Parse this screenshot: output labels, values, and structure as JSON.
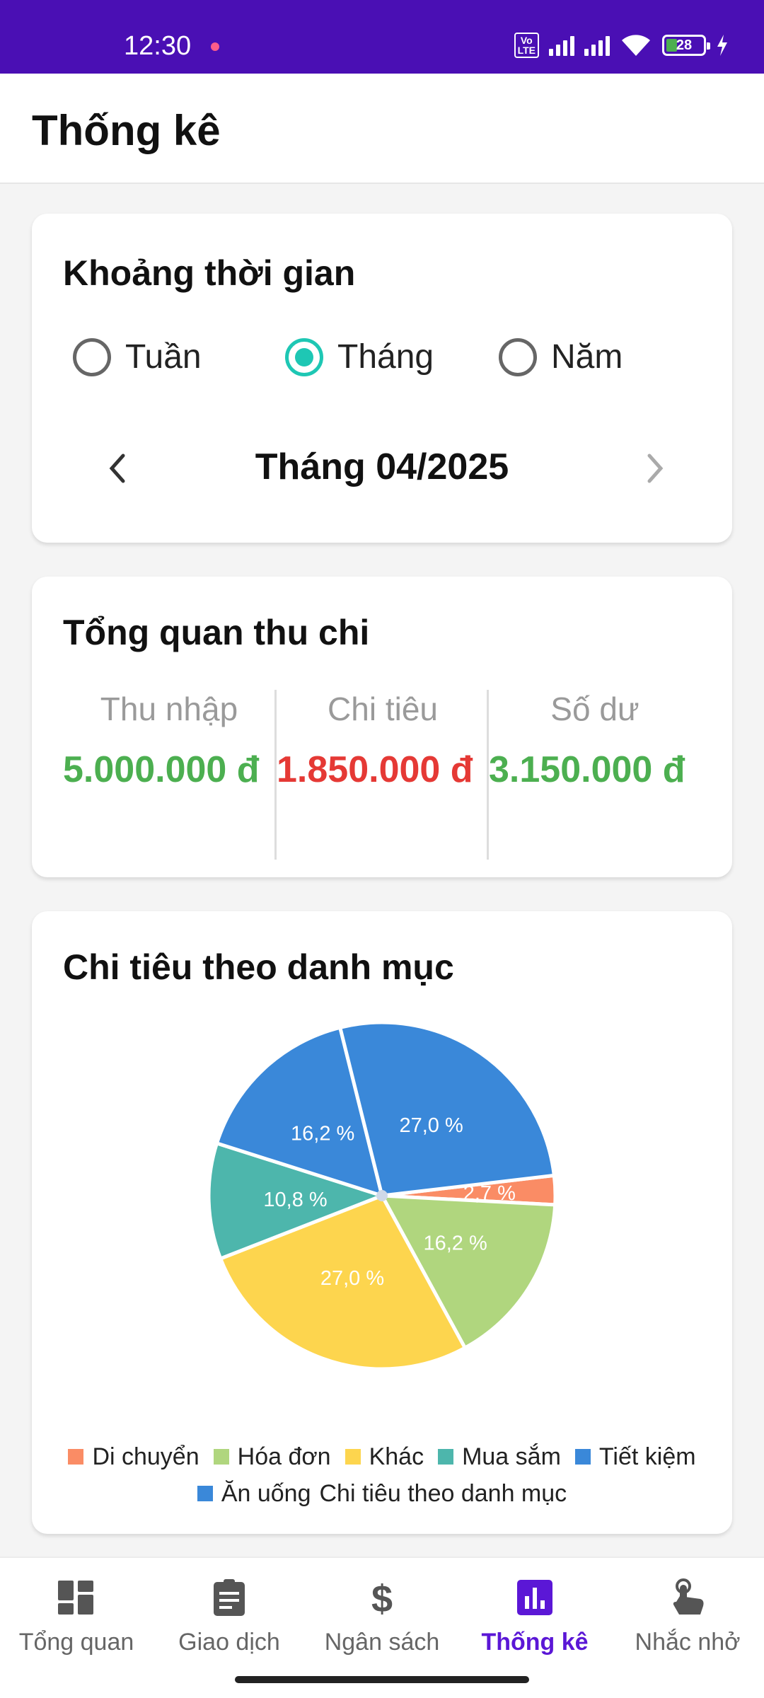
{
  "status_bar": {
    "time": "12:30",
    "volte_label": "Vo\nLTE",
    "battery_level": "28",
    "icons": [
      "notification-dot-icon",
      "volte-icon",
      "signal-icon",
      "signal-icon",
      "wifi-icon",
      "battery-icon",
      "charging-icon"
    ]
  },
  "app_bar": {
    "title": "Thống kê"
  },
  "period": {
    "title": "Khoảng thời gian",
    "options": [
      "Tuần",
      "Tháng",
      "Năm"
    ],
    "selected": "Tháng",
    "current_label": "Tháng 04/2025"
  },
  "overview": {
    "title": "Tổng quan thu chi",
    "income_label": "Thu nhập",
    "income_value": "5.000.000 đ",
    "expense_label": "Chi tiêu",
    "expense_value": "1.850.000 đ",
    "balance_label": "Số dư",
    "balance_value": "3.150.000 đ",
    "colors": {
      "positive": "#4caf50",
      "negative": "#e53935"
    }
  },
  "category_chart": {
    "title": "Chi tiêu theo danh mục",
    "legend_label": "Chi tiêu theo danh mục"
  },
  "chart_data": {
    "type": "pie",
    "categories": [
      "Di chuyển",
      "Hóa đơn",
      "Khác",
      "Mua sắm",
      "Tiết kiệm",
      "Ăn uống"
    ],
    "values": [
      2.7,
      16.2,
      27.0,
      10.8,
      16.2,
      27.0
    ],
    "labels": [
      "2,7 %",
      "16,2 %",
      "27,0 %",
      "10,8 %",
      "16,2 %",
      "27,0 %"
    ],
    "colors": [
      "#fa8c65",
      "#b0d67e",
      "#fdd54e",
      "#4db6ac",
      "#3a88d9",
      "#3a88d9"
    ]
  },
  "bottom_nav": {
    "items": [
      {
        "label": "Tổng quan",
        "icon": "dashboard-icon"
      },
      {
        "label": "Giao dịch",
        "icon": "clipboard-icon"
      },
      {
        "label": "Ngân sách",
        "icon": "dollar-icon"
      },
      {
        "label": "Thống kê",
        "icon": "bar-chart-icon"
      },
      {
        "label": "Nhắc nhở",
        "icon": "touch-icon"
      }
    ],
    "active": "Thống kê",
    "active_color": "#5b17d6"
  }
}
